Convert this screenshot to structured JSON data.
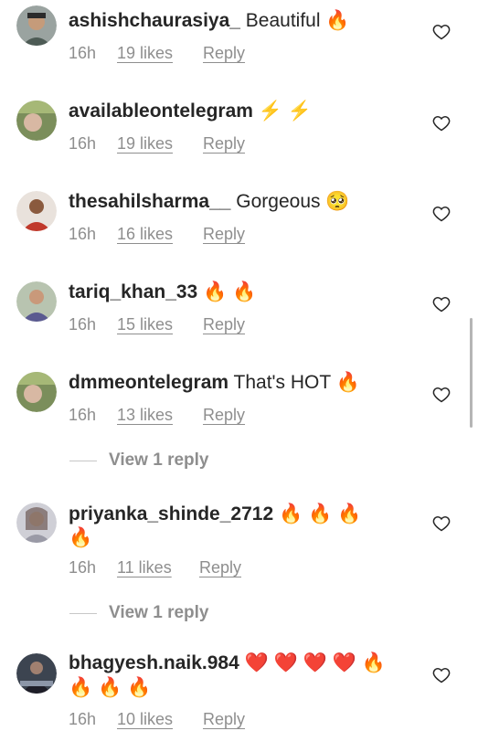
{
  "comments": [
    {
      "username": "ashishchaurasiya_",
      "text": "Beautiful",
      "emojis_after": "🔥",
      "time": "16h",
      "likes": "19 likes",
      "reply": "Reply",
      "avatar_color": "#5a6b5c"
    },
    {
      "username": "availableontelegram",
      "text": "",
      "emojis_after": "⚡ ⚡",
      "time": "16h",
      "likes": "19 likes",
      "reply": "Reply",
      "avatar_color": "#7b8e5b"
    },
    {
      "username": "thesahilsharma__",
      "text": "Gorgeous",
      "emojis_after": "🥺",
      "time": "16h",
      "likes": "16 likes",
      "reply": "Reply",
      "avatar_color": "#b8473d"
    },
    {
      "username": "tariq_khan_33",
      "text": "",
      "emojis_after": "🔥 🔥",
      "time": "16h",
      "likes": "15 likes",
      "reply": "Reply",
      "avatar_color": "#8a8aa0"
    },
    {
      "username": "dmmeontelegram",
      "text": "That's HOT",
      "emojis_after": "🔥",
      "time": "16h",
      "likes": "13 likes",
      "reply": "Reply",
      "avatar_color": "#7b8e5b",
      "view_replies": "View 1 reply"
    },
    {
      "username": "priyanka_shinde_2712",
      "text": "",
      "emojis_after": "🔥 🔥 🔥",
      "emojis_line2": "🔥",
      "time": "16h",
      "likes": "11 likes",
      "reply": "Reply",
      "avatar_color": "#a9a9b0",
      "view_replies": "View 1 reply"
    },
    {
      "username": "bhagyesh.naik.984",
      "text": "",
      "emojis_after": "❤️ ❤️ ❤️ ❤️ 🔥",
      "emojis_line2": "🔥 🔥 🔥",
      "time": "16h",
      "likes": "10 likes",
      "reply": "Reply",
      "avatar_color": "#3c4450"
    }
  ],
  "colors": {
    "fire": "#f08a1c",
    "bolt": "#f5b400",
    "heart": "#e0142c",
    "muted": "#8e8e8e"
  }
}
